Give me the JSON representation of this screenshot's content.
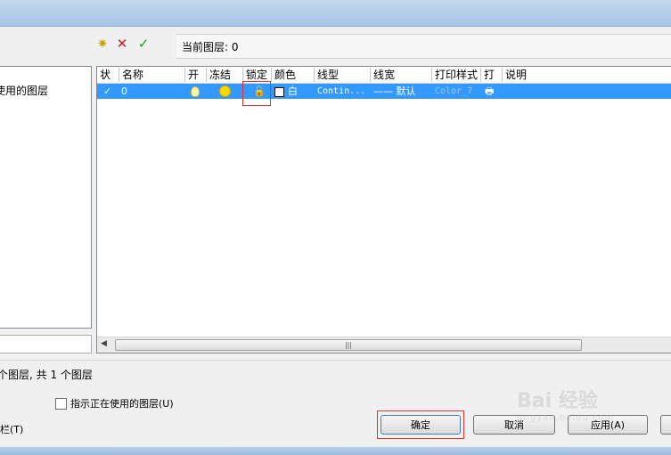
{
  "toolbar": {
    "new_layer_icon": "new-layer-icon",
    "delete_icon": "delete-icon",
    "set_current_icon": "set-current-icon",
    "current_layer_text": "当前图层: 0"
  },
  "tree": {
    "item": "使用的图层"
  },
  "grid": {
    "headers": [
      "状",
      "名称",
      "开",
      "冻结",
      "锁定",
      "颜色",
      "线型",
      "线宽",
      "打印样式",
      "打",
      "说明"
    ],
    "row": {
      "status": "✓",
      "name": "0",
      "color_name": "白",
      "linetype": "Contin...",
      "lineweight": "—— 默认",
      "plot_style": "Color_7"
    }
  },
  "status_bar": {
    "text": "个图层, 共 1 个图层"
  },
  "options": {
    "indicate_in_use": "指示正在使用的图层(U)",
    "left_partial": "栏(T)"
  },
  "buttons": {
    "ok": "确定",
    "cancel": "取消",
    "apply": "应用(A)"
  },
  "watermark": {
    "main": "Bai 经验",
    "sub": "jingyan.baidu.com"
  },
  "colors": {
    "selection": "#3399ff",
    "highlight_frame": "#e03030"
  }
}
